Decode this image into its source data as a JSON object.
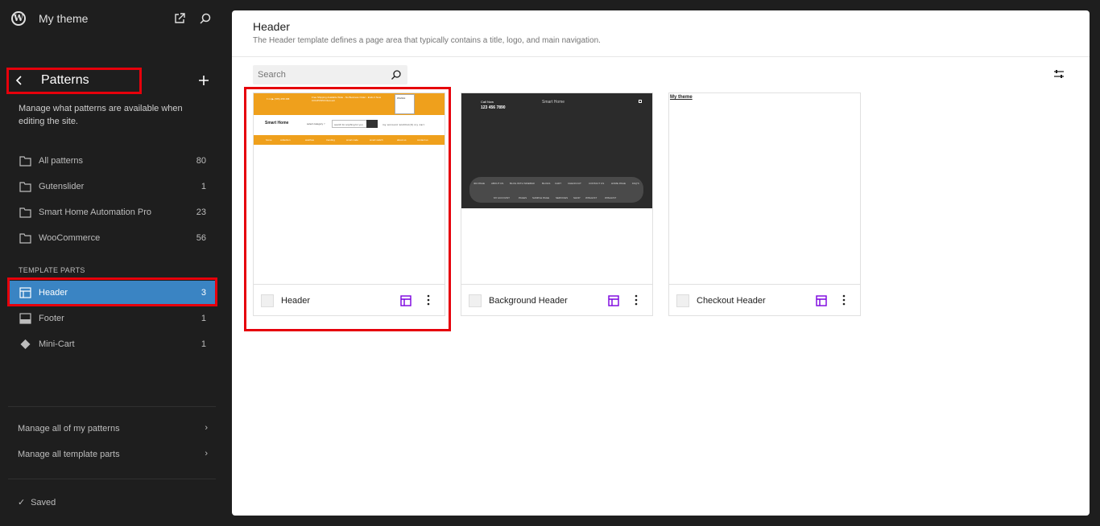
{
  "site": {
    "name": "My theme"
  },
  "sidebar": {
    "title": "Patterns",
    "description": "Manage what patterns are available when editing the site.",
    "categories": [
      {
        "label": "All patterns",
        "count": "80"
      },
      {
        "label": "Gutenslider",
        "count": "1"
      },
      {
        "label": "Smart Home Automation Pro",
        "count": "23"
      },
      {
        "label": "WooCommerce",
        "count": "56"
      }
    ],
    "template_parts_label": "TEMPLATE PARTS",
    "template_parts": [
      {
        "label": "Header",
        "count": "3"
      },
      {
        "label": "Footer",
        "count": "1"
      },
      {
        "label": "Mini-Cart",
        "count": "1"
      }
    ],
    "manage_patterns": "Manage all of my patterns",
    "manage_template_parts": "Manage all template parts",
    "saved": "Saved"
  },
  "main": {
    "title": "Header",
    "description": "The Header template defines a page area that typically contains a title, logo, and main navigation.",
    "search_placeholder": "Search",
    "cards": [
      {
        "label": "Header"
      },
      {
        "label": "Background Header"
      },
      {
        "label": "Checkout Header"
      }
    ]
  },
  "thumbnails": {
    "header": {
      "phone": "f  t  in  ▶  (785) 258 158",
      "notice": "Free Shipping Available Wide - No Business Order - Ends It Now\nCOUPON50 Discount",
      "box_title": "Wishlist",
      "logo": "Smart Home",
      "select": "select category ˅",
      "search": "search for anything for you",
      "links": "my account  wishlist(0)  my cart",
      "nav": [
        "home",
        "collection",
        "watches",
        "trending",
        "smart code",
        "smart switch",
        "about us",
        "contact us"
      ]
    },
    "background_header": {
      "call": "Call Now",
      "phone": "123 456 7890",
      "logo": "Smart Home",
      "menu_row1": [
        "404 PAGE",
        "ABOUT US",
        "BLOG WITH SIDEBAR",
        "BLOGS",
        "CART",
        "CHECKOUT",
        "CONTACT US",
        "HOME PAGE",
        "FAQ'S"
      ],
      "menu_row2": [
        "MY ACCOUNT",
        "PAGES",
        "SAMPLE PAGE",
        "SERVICES",
        "SHOP",
        "WISHLIST",
        "WISHLIST"
      ]
    },
    "checkout_header": {
      "site_title": "My theme"
    }
  },
  "colors": {
    "accent": "#3a84c3",
    "highlight": "#e6000b",
    "template_icon": "#7a00df"
  }
}
